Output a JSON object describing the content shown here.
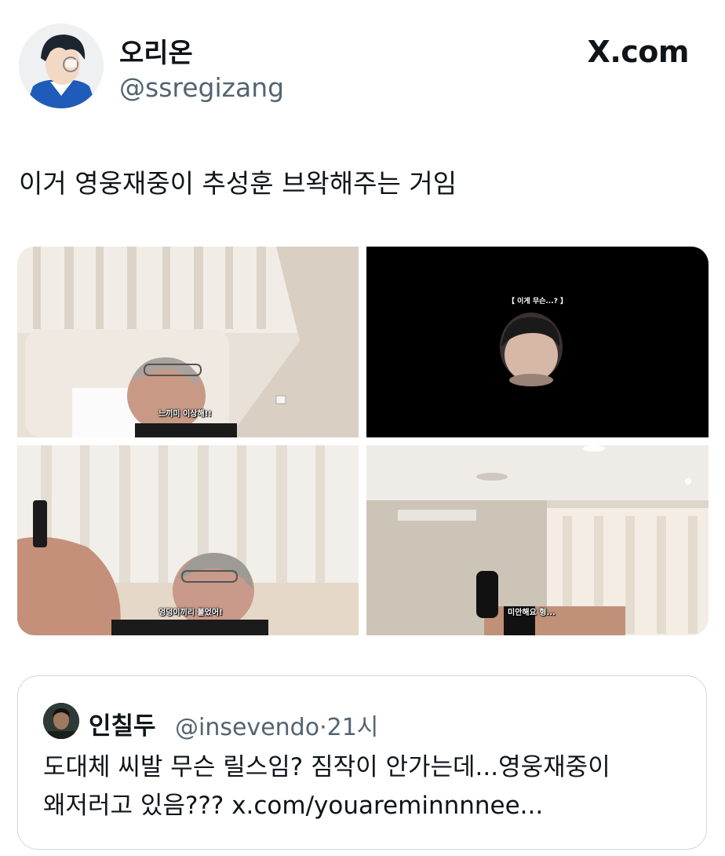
{
  "author": {
    "display_name": "오리온",
    "handle": "@ssregizang"
  },
  "source_site": "X.com",
  "tweet": {
    "text": "이거 영웅재중이 추성훈 브왁해주는 거임"
  },
  "media": {
    "subtitles": {
      "image1": "느끼미 이상해!!",
      "image2_top": "【 이게 무슨...? 】",
      "image3": "엉덩이끼리 붙었어!",
      "image4": "미안해요 형..."
    }
  },
  "quoted_tweet": {
    "display_name": "인칠두",
    "handle": "@insevendo",
    "separator": "·",
    "time": "21시",
    "text_line1": "도대체 씨발 무슨 릴스임? 짐작이 안가는데...영웅재중이",
    "text_line2": "왜저러고 있음??? x.com/youareminnnnee..."
  },
  "colors": {
    "text_primary": "#0f1419",
    "text_secondary": "#536471",
    "border": "#cfd9de"
  }
}
